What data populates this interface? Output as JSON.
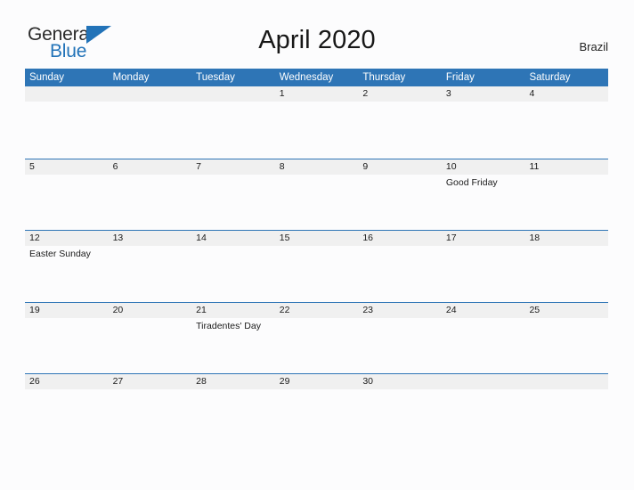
{
  "brand": {
    "name_part1": "General",
    "name_part2": "Blue",
    "triangle_color": "#2273b8"
  },
  "header": {
    "title": "April 2020",
    "country": "Brazil"
  },
  "colors": {
    "header_blue": "#2e75b6",
    "date_band_gray": "#f0f0f0",
    "page_background": "#fcfcfd",
    "text_dark": "#1a1a1a"
  },
  "calendar": {
    "weekday_headers": [
      "Sunday",
      "Monday",
      "Tuesday",
      "Wednesday",
      "Thursday",
      "Friday",
      "Saturday"
    ],
    "weeks": [
      {
        "days": [
          {
            "date": "",
            "events": []
          },
          {
            "date": "",
            "events": []
          },
          {
            "date": "",
            "events": []
          },
          {
            "date": "1",
            "events": []
          },
          {
            "date": "2",
            "events": []
          },
          {
            "date": "3",
            "events": []
          },
          {
            "date": "4",
            "events": []
          }
        ]
      },
      {
        "days": [
          {
            "date": "5",
            "events": []
          },
          {
            "date": "6",
            "events": []
          },
          {
            "date": "7",
            "events": []
          },
          {
            "date": "8",
            "events": []
          },
          {
            "date": "9",
            "events": []
          },
          {
            "date": "10",
            "events": [
              "Good Friday"
            ]
          },
          {
            "date": "11",
            "events": []
          }
        ]
      },
      {
        "days": [
          {
            "date": "12",
            "events": [
              "Easter Sunday"
            ]
          },
          {
            "date": "13",
            "events": []
          },
          {
            "date": "14",
            "events": []
          },
          {
            "date": "15",
            "events": []
          },
          {
            "date": "16",
            "events": []
          },
          {
            "date": "17",
            "events": []
          },
          {
            "date": "18",
            "events": []
          }
        ]
      },
      {
        "days": [
          {
            "date": "19",
            "events": []
          },
          {
            "date": "20",
            "events": []
          },
          {
            "date": "21",
            "events": [
              "Tiradentes' Day"
            ]
          },
          {
            "date": "22",
            "events": []
          },
          {
            "date": "23",
            "events": []
          },
          {
            "date": "24",
            "events": []
          },
          {
            "date": "25",
            "events": []
          }
        ]
      },
      {
        "days": [
          {
            "date": "26",
            "events": []
          },
          {
            "date": "27",
            "events": []
          },
          {
            "date": "28",
            "events": []
          },
          {
            "date": "29",
            "events": []
          },
          {
            "date": "30",
            "events": []
          },
          {
            "date": "",
            "events": []
          },
          {
            "date": "",
            "events": []
          }
        ]
      }
    ]
  }
}
